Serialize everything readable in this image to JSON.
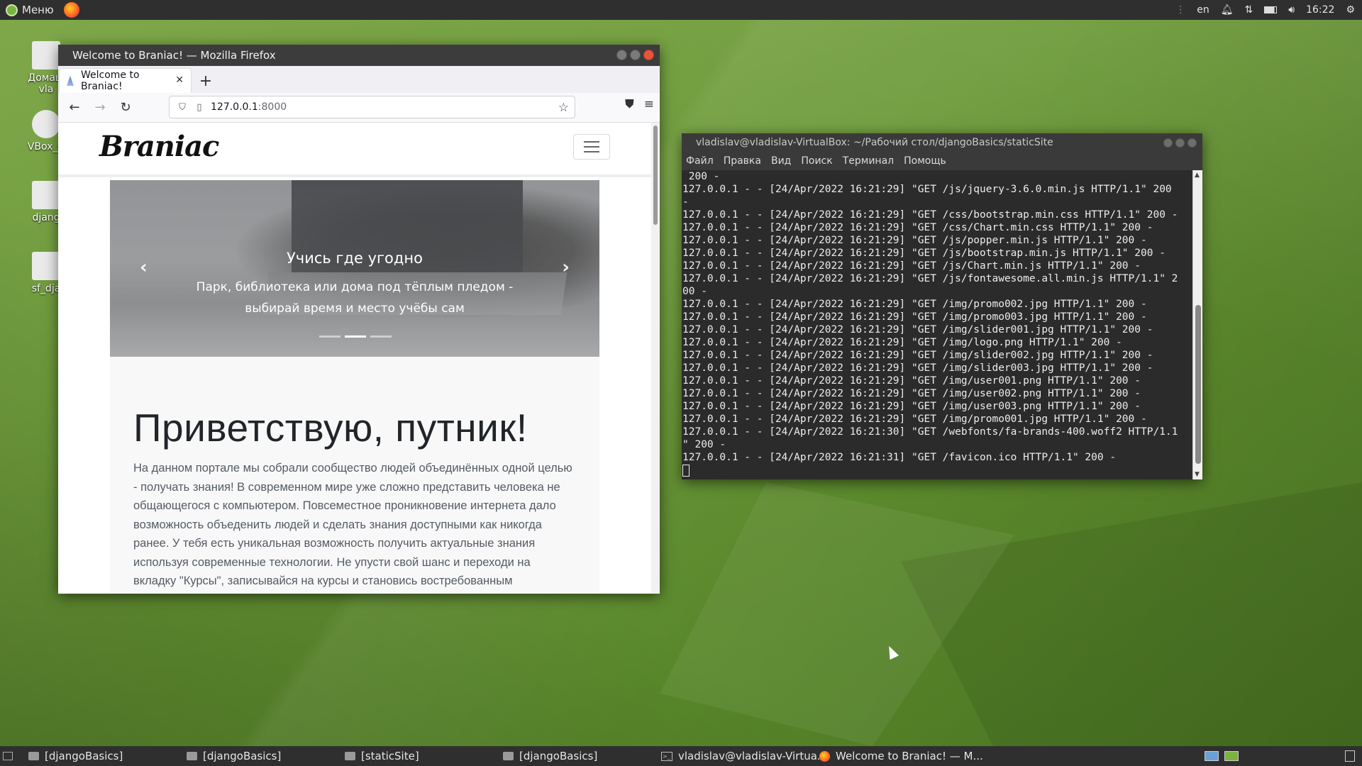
{
  "top_panel": {
    "menu_label": "Меню",
    "lang": "en",
    "clock": "16:22"
  },
  "desktop_icons": [
    {
      "label": "Домаш\nvla"
    },
    {
      "label": "VBox_C"
    },
    {
      "label": "djang"
    },
    {
      "label": "sf_dja"
    }
  ],
  "firefox": {
    "window_title": "Welcome to Braniac! — Mozilla Firefox",
    "tab_title": "Welcome to Braniac!",
    "url_host": "127.0.0.1",
    "url_port": ":8000",
    "site": {
      "brand": "Braniac",
      "carousel_title": "Учись где угодно",
      "carousel_text": "Парк, библиотека или дома под тёплым пледом - выбирай время и место учёбы сам",
      "heading": "Приветствую, путник!",
      "paragraph": "На данном портале мы собрали сообщество людей объединённых одной целью - получать знания! В современном мире уже сложно представить человека не общающегося с компьютером. Повсеместное проникновение интернета дало возможность объеденить людей и сделать знания доступными как никогда ранее. У тебя есть уникальная возможность получить актуальные знания используя современные технологии. Не упусти свой шанс и переходи на вкладку \"Курсы\", записывайся на курсы и становись востребованным специалистом."
    }
  },
  "terminal": {
    "window_title": "vladislav@vladislav-VirtualBox: ~/Рабочий стол/djangoBasics/staticSite",
    "menu": [
      "Файл",
      "Правка",
      "Вид",
      "Поиск",
      "Терминал",
      "Помощь"
    ],
    "lines": [
      " 200 -",
      "127.0.0.1 - - [24/Apr/2022 16:21:29] \"GET /js/jquery-3.6.0.min.js HTTP/1.1\" 200",
      "-",
      "127.0.0.1 - - [24/Apr/2022 16:21:29] \"GET /css/bootstrap.min.css HTTP/1.1\" 200 -",
      "127.0.0.1 - - [24/Apr/2022 16:21:29] \"GET /css/Chart.min.css HTTP/1.1\" 200 -",
      "127.0.0.1 - - [24/Apr/2022 16:21:29] \"GET /js/popper.min.js HTTP/1.1\" 200 -",
      "127.0.0.1 - - [24/Apr/2022 16:21:29] \"GET /js/bootstrap.min.js HTTP/1.1\" 200 -",
      "127.0.0.1 - - [24/Apr/2022 16:21:29] \"GET /js/Chart.min.js HTTP/1.1\" 200 -",
      "127.0.0.1 - - [24/Apr/2022 16:21:29] \"GET /js/fontawesome.all.min.js HTTP/1.1\" 2",
      "00 -",
      "127.0.0.1 - - [24/Apr/2022 16:21:29] \"GET /img/promo002.jpg HTTP/1.1\" 200 -",
      "127.0.0.1 - - [24/Apr/2022 16:21:29] \"GET /img/promo003.jpg HTTP/1.1\" 200 -",
      "127.0.0.1 - - [24/Apr/2022 16:21:29] \"GET /img/slider001.jpg HTTP/1.1\" 200 -",
      "127.0.0.1 - - [24/Apr/2022 16:21:29] \"GET /img/logo.png HTTP/1.1\" 200 -",
      "127.0.0.1 - - [24/Apr/2022 16:21:29] \"GET /img/slider002.jpg HTTP/1.1\" 200 -",
      "127.0.0.1 - - [24/Apr/2022 16:21:29] \"GET /img/slider003.jpg HTTP/1.1\" 200 -",
      "127.0.0.1 - - [24/Apr/2022 16:21:29] \"GET /img/user001.png HTTP/1.1\" 200 -",
      "127.0.0.1 - - [24/Apr/2022 16:21:29] \"GET /img/user002.png HTTP/1.1\" 200 -",
      "127.0.0.1 - - [24/Apr/2022 16:21:29] \"GET /img/user003.png HTTP/1.1\" 200 -",
      "127.0.0.1 - - [24/Apr/2022 16:21:29] \"GET /img/promo001.jpg HTTP/1.1\" 200 -",
      "127.0.0.1 - - [24/Apr/2022 16:21:30] \"GET /webfonts/fa-brands-400.woff2 HTTP/1.1",
      "\" 200 -",
      "127.0.0.1 - - [24/Apr/2022 16:21:31] \"GET /favicon.ico HTTP/1.1\" 200 -"
    ]
  },
  "taskbar": {
    "items": [
      {
        "label": "[djangoBasics]",
        "icon": "folder-icon"
      },
      {
        "label": "[djangoBasics]",
        "icon": "folder-icon"
      },
      {
        "label": "[staticSite]",
        "icon": "folder-icon"
      },
      {
        "label": "[djangoBasics]",
        "icon": "folder-icon"
      },
      {
        "label": "vladislav@vladislav-Virtua...",
        "icon": "terminal-icon"
      },
      {
        "label": "Welcome to Braniac! — M...",
        "icon": "firefox-icon"
      }
    ]
  }
}
